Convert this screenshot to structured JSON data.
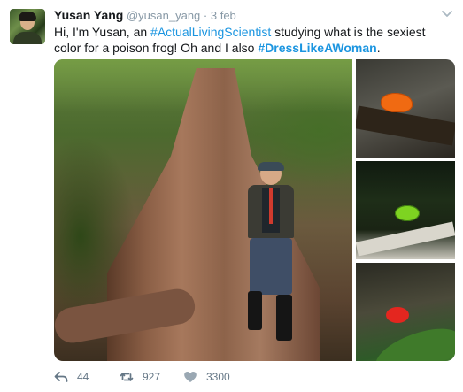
{
  "author": {
    "name": "Yusan Yang",
    "handle": "@yusan_yang",
    "separator": "·",
    "time": "3 feb"
  },
  "tweet": {
    "text_1": "Hi, I'm Yusan, an ",
    "hashtag_1": "#ActualLivingScientist",
    "text_2": " studying what is the sexiest color for a poison frog!  Oh and I also ",
    "hashtag_2": "#DressLikeAWoman",
    "text_3": "."
  },
  "actions": {
    "reply_count": "44",
    "retweet_count": "927",
    "like_count": "3300"
  },
  "icons": {
    "reply": "reply-icon",
    "retweet": "retweet-icon",
    "like": "heart-icon",
    "menu": "chevron-down-icon"
  },
  "colors": {
    "link": "#1b95e0",
    "muted": "#8899a6",
    "action": "#657786"
  }
}
